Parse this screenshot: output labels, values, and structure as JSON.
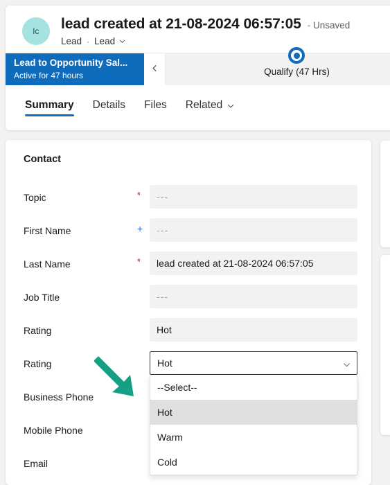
{
  "header": {
    "avatar_initials": "lc",
    "record_title": "lead created at 21-08-2024 06:57:05",
    "unsaved_label": "- Unsaved",
    "entity_label": "Lead",
    "separator": "·",
    "form_label": "Lead",
    "form_chevron_icon": "chevron-down-icon"
  },
  "process_flow": {
    "name": "Lead to Opportunity Sal...",
    "status": "Active for 47 hours",
    "collapse_icon": "chevron-left-icon",
    "stages": [
      {
        "label": "Qualify",
        "duration": "(47 Hrs)",
        "active": true,
        "icon": "stage-active-ring-icon"
      }
    ]
  },
  "tabs": [
    {
      "label": "Summary",
      "active": true,
      "has_chevron": false
    },
    {
      "label": "Details",
      "active": false,
      "has_chevron": false
    },
    {
      "label": "Files",
      "active": false,
      "has_chevron": false
    },
    {
      "label": "Related",
      "active": false,
      "has_chevron": true
    }
  ],
  "contact_section": {
    "title": "Contact",
    "fields": [
      {
        "label": "Topic",
        "required_mark": "*",
        "required_type": "star",
        "type": "readonly",
        "value": "---",
        "is_placeholder": true
      },
      {
        "label": "First Name",
        "required_mark": "+",
        "required_type": "plus",
        "type": "readonly",
        "value": "---",
        "is_placeholder": true
      },
      {
        "label": "Last Name",
        "required_mark": "*",
        "required_type": "star",
        "type": "readonly",
        "value": "lead created at 21-08-2024 06:57:05",
        "is_placeholder": false
      },
      {
        "label": "Job Title",
        "required_mark": "",
        "required_type": "none",
        "type": "readonly",
        "value": "---",
        "is_placeholder": true
      },
      {
        "label": "Rating",
        "required_mark": "",
        "required_type": "none",
        "type": "readonly",
        "value": "Hot",
        "is_placeholder": false
      },
      {
        "label": "Rating",
        "required_mark": "",
        "required_type": "none",
        "type": "combobox",
        "value": "Hot",
        "is_placeholder": false
      },
      {
        "label": "Business Phone",
        "required_mark": "",
        "required_type": "none",
        "type": "hidden-behind-dropdown",
        "value": "",
        "is_placeholder": false
      },
      {
        "label": "Mobile Phone",
        "required_mark": "",
        "required_type": "none",
        "type": "hidden-behind-dropdown",
        "value": "",
        "is_placeholder": false
      },
      {
        "label": "Email",
        "required_mark": "",
        "required_type": "none",
        "type": "hidden-behind-dropdown",
        "value": "",
        "is_placeholder": false
      }
    ]
  },
  "rating_dropdown": {
    "expanded": true,
    "selected_value": "Hot",
    "chevron_icon": "chevron-down-icon",
    "options": [
      {
        "label": "--Select--",
        "selected": false
      },
      {
        "label": "Hot",
        "selected": true
      },
      {
        "label": "Warm",
        "selected": false
      },
      {
        "label": "Cold",
        "selected": false
      }
    ]
  },
  "annotation": {
    "arrow_icon": "arrow-down-right-icon",
    "color": "#14a085"
  },
  "colors": {
    "accent_blue": "#0f6cbd",
    "required_red": "#a4262c",
    "recommended_blue": "#2266cc",
    "avatar_teal": "#a5e3e0",
    "page_background": "#f3f2f1",
    "field_background": "#f3f2f1",
    "option_highlight": "#e1dfdd",
    "annotation_teal": "#14a085"
  }
}
